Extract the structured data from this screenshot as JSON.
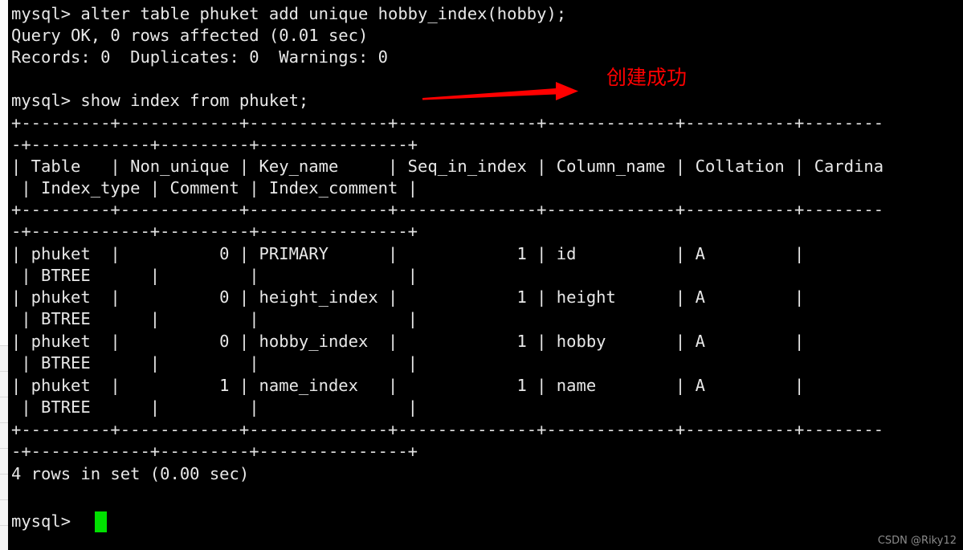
{
  "terminal": {
    "prompt": "mysql>",
    "font_color": "#e8e8e8",
    "background": "#000000",
    "cursor_color": "#00e000",
    "lines": [
      {
        "id": "cmd-alter",
        "text": "mysql> alter table phuket add unique hobby_index(hobby);"
      },
      {
        "id": "result-query-ok",
        "text": "Query OK, 0 rows affected (0.01 sec)"
      },
      {
        "id": "result-records",
        "text": "Records: 0  Duplicates: 0  Warnings: 0"
      },
      {
        "id": "blank-1",
        "text": ""
      },
      {
        "id": "cmd-show-index",
        "text": "mysql> show index from phuket;"
      },
      {
        "id": "sep-top-a",
        "text": "+---------+------------+--------------+--------------+-------------+-----------+--------"
      },
      {
        "id": "sep-top-b",
        "text": "-+------------+---------+---------------+"
      },
      {
        "id": "header-a",
        "text": "| Table   | Non_unique | Key_name     | Seq_in_index | Column_name | Collation | Cardina"
      },
      {
        "id": "header-b",
        "text": " | Index_type | Comment | Index_comment |"
      },
      {
        "id": "sep-mid-a",
        "text": "+---------+------------+--------------+--------------+-------------+-----------+--------"
      },
      {
        "id": "sep-mid-b",
        "text": "-+------------+---------+---------------+"
      },
      {
        "id": "row1-a",
        "text": "| phuket  |          0 | PRIMARY      |            1 | id          | A         |"
      },
      {
        "id": "row1-b",
        "text": " | BTREE      |         |               |"
      },
      {
        "id": "row2-a",
        "text": "| phuket  |          0 | height_index |            1 | height      | A         |"
      },
      {
        "id": "row2-b",
        "text": " | BTREE      |         |               |"
      },
      {
        "id": "row3-a",
        "text": "| phuket  |          0 | hobby_index  |            1 | hobby       | A         |"
      },
      {
        "id": "row3-b",
        "text": " | BTREE      |         |               |"
      },
      {
        "id": "row4-a",
        "text": "| phuket  |          1 | name_index   |            1 | name        | A         |"
      },
      {
        "id": "row4-b",
        "text": " | BTREE      |         |               |"
      },
      {
        "id": "sep-bot-a",
        "text": "+---------+------------+--------------+--------------+-------------+-----------+--------"
      },
      {
        "id": "sep-bot-b",
        "text": "-+------------+---------+---------------+"
      },
      {
        "id": "rowcount",
        "text": "4 rows in set (0.00 sec)"
      },
      {
        "id": "blank-2",
        "text": ""
      },
      {
        "id": "prompt-final",
        "text": "mysql>"
      }
    ]
  },
  "result_table": {
    "columns": [
      "Table",
      "Non_unique",
      "Key_name",
      "Seq_in_index",
      "Column_name",
      "Collation",
      "Cardina",
      "Index_type",
      "Comment",
      "Index_comment"
    ],
    "rows": [
      {
        "Table": "phuket",
        "Non_unique": "0",
        "Key_name": "PRIMARY",
        "Seq_in_index": "1",
        "Column_name": "id",
        "Collation": "A",
        "Cardina": "",
        "Index_type": "BTREE",
        "Comment": "",
        "Index_comment": ""
      },
      {
        "Table": "phuket",
        "Non_unique": "0",
        "Key_name": "height_index",
        "Seq_in_index": "1",
        "Column_name": "height",
        "Collation": "A",
        "Cardina": "",
        "Index_type": "BTREE",
        "Comment": "",
        "Index_comment": ""
      },
      {
        "Table": "phuket",
        "Non_unique": "0",
        "Key_name": "hobby_index",
        "Seq_in_index": "1",
        "Column_name": "hobby",
        "Collation": "A",
        "Cardina": "",
        "Index_type": "BTREE",
        "Comment": "",
        "Index_comment": ""
      },
      {
        "Table": "phuket",
        "Non_unique": "1",
        "Key_name": "name_index",
        "Seq_in_index": "1",
        "Column_name": "name",
        "Collation": "A",
        "Cardina": "",
        "Index_type": "BTREE",
        "Comment": "",
        "Index_comment": ""
      }
    ],
    "row_count_text": "4 rows in set (0.00 sec)"
  },
  "annotation": {
    "text": "创建成功",
    "color": "#ff0000",
    "arrow_name": "red-arrow-right"
  },
  "watermark": {
    "text": "CSDN @Riky12",
    "color": "#8b8b8b"
  }
}
